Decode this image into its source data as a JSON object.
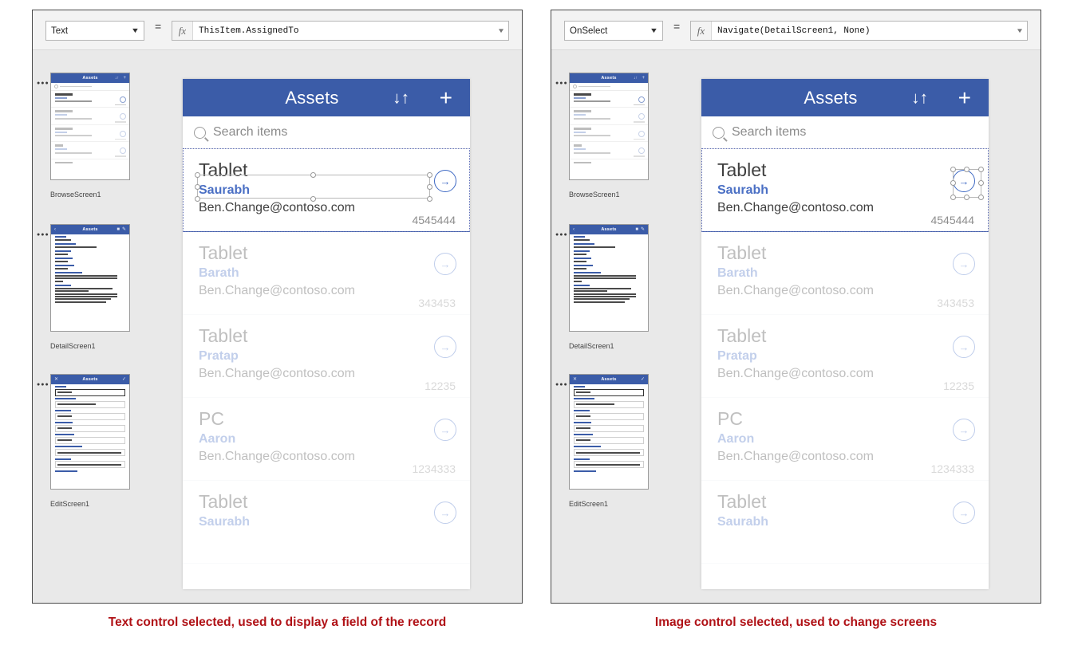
{
  "panels": [
    {
      "id": "left",
      "formula_bar": {
        "property": "Text",
        "equals": "=",
        "fx_icon": "fx",
        "formula": "ThisItem.AssignedTo",
        "expand_icon": "chevron-down"
      },
      "caption": "Text control selected, used to display a field of the record",
      "selection": "text-control"
    },
    {
      "id": "right",
      "formula_bar": {
        "property": "OnSelect",
        "equals": "=",
        "fx_icon": "fx",
        "formula": "Navigate(DetailScreen1, None)",
        "expand_icon": "chevron-down"
      },
      "caption": "Image control selected, used to change screens",
      "selection": "image-control"
    }
  ],
  "screen_rail": {
    "thumbnails": [
      {
        "label": "BrowseScreen1",
        "kind": "browse"
      },
      {
        "label": "DetailScreen1",
        "kind": "detail"
      },
      {
        "label": "EditScreen1",
        "kind": "edit"
      }
    ]
  },
  "app": {
    "header": {
      "title": "Assets",
      "sort_icon": "↓↑",
      "add_icon": "+"
    },
    "search": {
      "icon": "search-icon",
      "placeholder": "Search items"
    },
    "items": [
      {
        "title": "Tablet",
        "assigned_to": "Saurabh",
        "email": "Ben.Change@contoso.com",
        "asset_id": "4545444",
        "chevron": "→",
        "selected": true
      },
      {
        "title": "Tablet",
        "assigned_to": "Barath",
        "email": "Ben.Change@contoso.com",
        "asset_id": "343453",
        "chevron": "→",
        "selected": false
      },
      {
        "title": "Tablet",
        "assigned_to": "Pratap",
        "email": "Ben.Change@contoso.com",
        "asset_id": "12235",
        "chevron": "→",
        "selected": false
      },
      {
        "title": "PC",
        "assigned_to": "Aaron",
        "email": "Ben.Change@contoso.com",
        "asset_id": "1234333",
        "chevron": "→",
        "selected": false
      },
      {
        "title": "Tablet",
        "assigned_to": "Saurabh",
        "email": "",
        "asset_id": "",
        "chevron": "→",
        "selected": false
      }
    ]
  },
  "colors": {
    "header_blue": "#3b5ca8",
    "link_blue": "#4a6fc4",
    "caption_red": "#b01116",
    "canvas_grey": "#e9e9e9"
  }
}
